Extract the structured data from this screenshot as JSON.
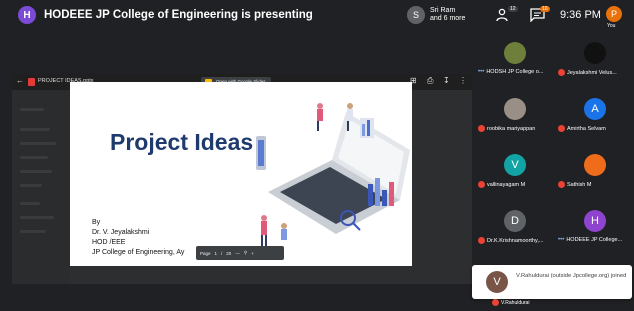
{
  "header": {
    "presenter_initial": "H",
    "title": "HODEEE JP College of Engineering is presenting",
    "presenters_initial": "S",
    "presenters_line1": "Sri Ram",
    "presenters_line2": "and 6 more",
    "people_count": "12",
    "chat_count": "10",
    "time": "9:36 PM",
    "you_initial": "P",
    "you_label": "You"
  },
  "viewer": {
    "file_name": "PROJECT IDEAS.pptx",
    "open_with": "Open with Google Slides",
    "slide": {
      "title": "Project Ideas",
      "by": "By",
      "author": "Dr. V. Jeyalakshmi",
      "role": "HOD /EEE",
      "college": "JP College of Engineering, Ay"
    },
    "pager": {
      "label": "Page",
      "current": "1",
      "sep": "/",
      "total": "20",
      "minus": "—",
      "plus": "+"
    }
  },
  "participants": [
    {
      "name": "HODSH JP College o...",
      "initial": "",
      "color": "#6d7f3a",
      "mic_off": false,
      "dots": true
    },
    {
      "name": "Jeyalakshmi Velus...",
      "initial": "",
      "color": "#111111",
      "mic_off": true,
      "dots": false
    },
    {
      "name": "roobika mariyappan",
      "initial": "",
      "color": "#9a8f86",
      "mic_off": true,
      "dots": false
    },
    {
      "name": "Amirtha Selvam",
      "initial": "A",
      "color": "#1a73e8",
      "mic_off": true,
      "dots": false
    },
    {
      "name": "vallinayagam M",
      "initial": "V",
      "color": "#12a4a4",
      "mic_off": true,
      "dots": false
    },
    {
      "name": "Sathish M",
      "initial": "",
      "color": "#ee6c1a",
      "mic_off": true,
      "dots": false
    },
    {
      "name": "Dr.K.Krishnamoorthy,...",
      "initial": "D",
      "color": "#5f6368",
      "mic_off": true,
      "dots": false
    },
    {
      "name": "HODEEE JP College...",
      "initial": "H",
      "color": "#8e44cf",
      "mic_off": false,
      "dots": true
    }
  ],
  "toast": {
    "initial": "V",
    "text": "V.Rahuldurai (outside Jpcollege.org) joined"
  },
  "under_tile_name": "V.Rahuldurai"
}
